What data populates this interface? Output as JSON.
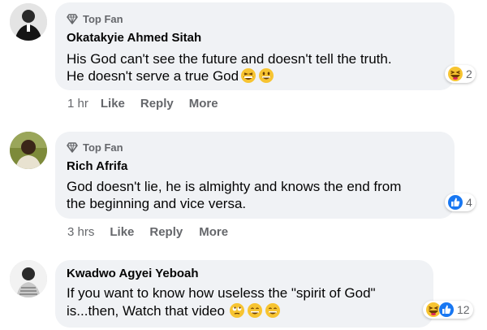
{
  "comments": [
    {
      "badge": "Top Fan",
      "author": "Okatakyie Ahmed Sitah",
      "lines": [
        "His God can't see the future and doesn't tell the truth.",
        "He doesn't serve a true God"
      ],
      "inline_emojis": [
        "grinning-squint-emoji",
        "grinning-emoji"
      ],
      "time": "1 hr",
      "like": "Like",
      "reply": "Reply",
      "more": "More",
      "reaction_icons": [
        "haha-reaction-icon"
      ],
      "reaction_count": "2"
    },
    {
      "badge": "Top Fan",
      "author": "Rich Afrifa",
      "lines": [
        "God doesn't lie, he is almighty and knows the end from",
        "the beginning and vice versa."
      ],
      "inline_emojis": [],
      "time": "3 hrs",
      "like": "Like",
      "reply": "Reply",
      "more": "More",
      "reaction_icons": [
        "like-reaction-icon"
      ],
      "reaction_count": "4"
    },
    {
      "badge": "",
      "author": "Kwadwo Agyei Yeboah",
      "lines": [
        "If you want to know how useless the \"spirit of God\"",
        "is...then, Watch that video"
      ],
      "inline_emojis": [
        "rolling-eyes-emoji",
        "grinning-emoji",
        "grinning-emoji"
      ],
      "time": "",
      "like": "",
      "reply": "",
      "more": "",
      "reaction_icons": [
        "haha-reaction-icon",
        "like-reaction-icon"
      ],
      "reaction_count": "12"
    }
  ],
  "colors": {
    "bubble": "#f0f2f5",
    "secondary_text": "#65676b",
    "like_blue": "#1877f2",
    "emoji_yellow": "#f7c431"
  }
}
